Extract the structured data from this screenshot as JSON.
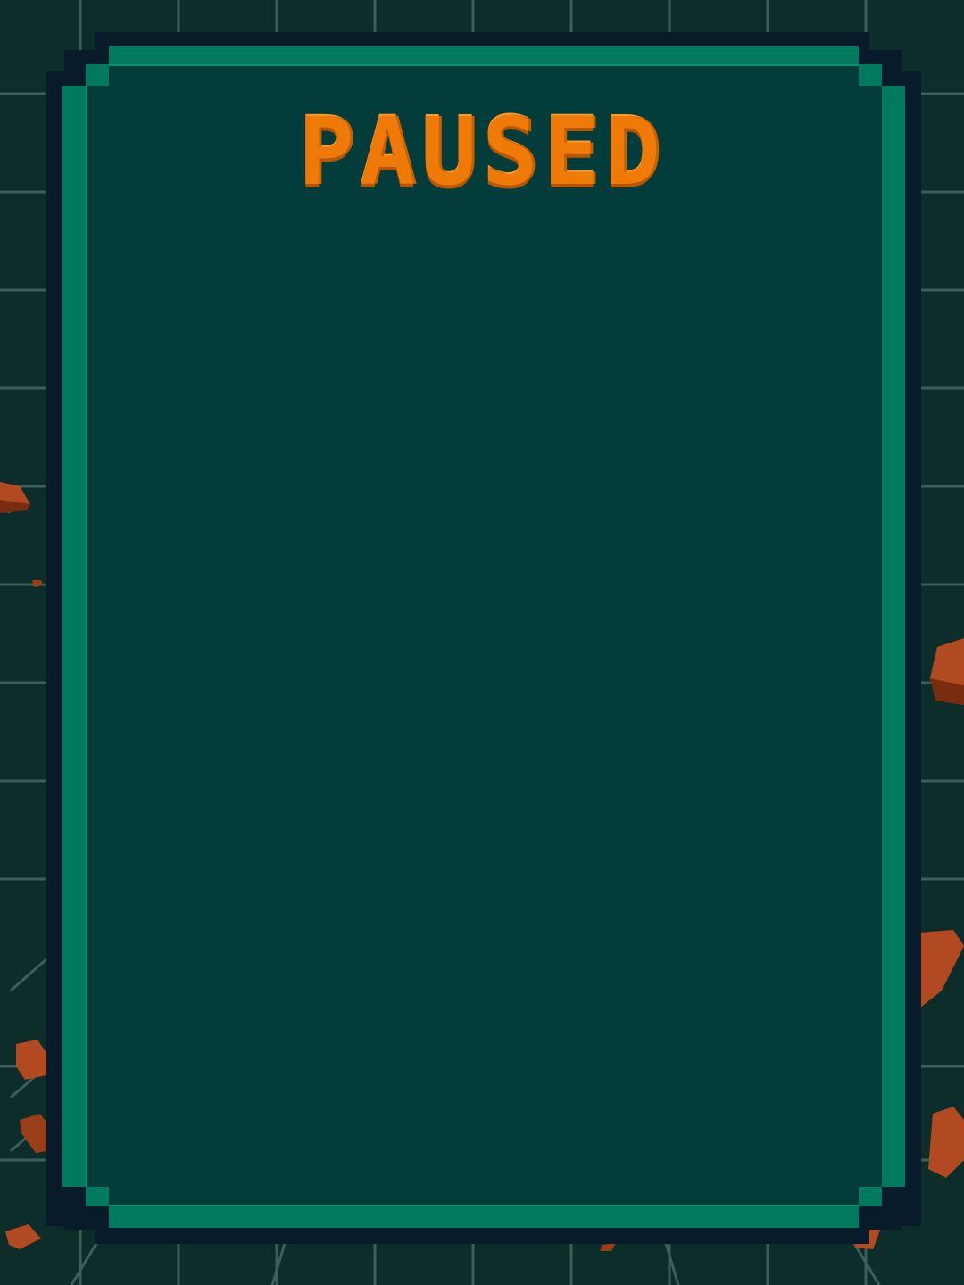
{
  "pause_menu": {
    "title": "PAUSED"
  },
  "colors": {
    "background": "#0c2d29",
    "grid_line": "#3d5e59",
    "panel_outer_border": "#071b2a",
    "panel_border": "#007a5e",
    "panel_inner_border": "#02926e",
    "panel_fill": "#023d3c",
    "title": "#f07a08",
    "debris": "#b14a20"
  },
  "icons": {
    "debris": "brick-debris-icon"
  }
}
